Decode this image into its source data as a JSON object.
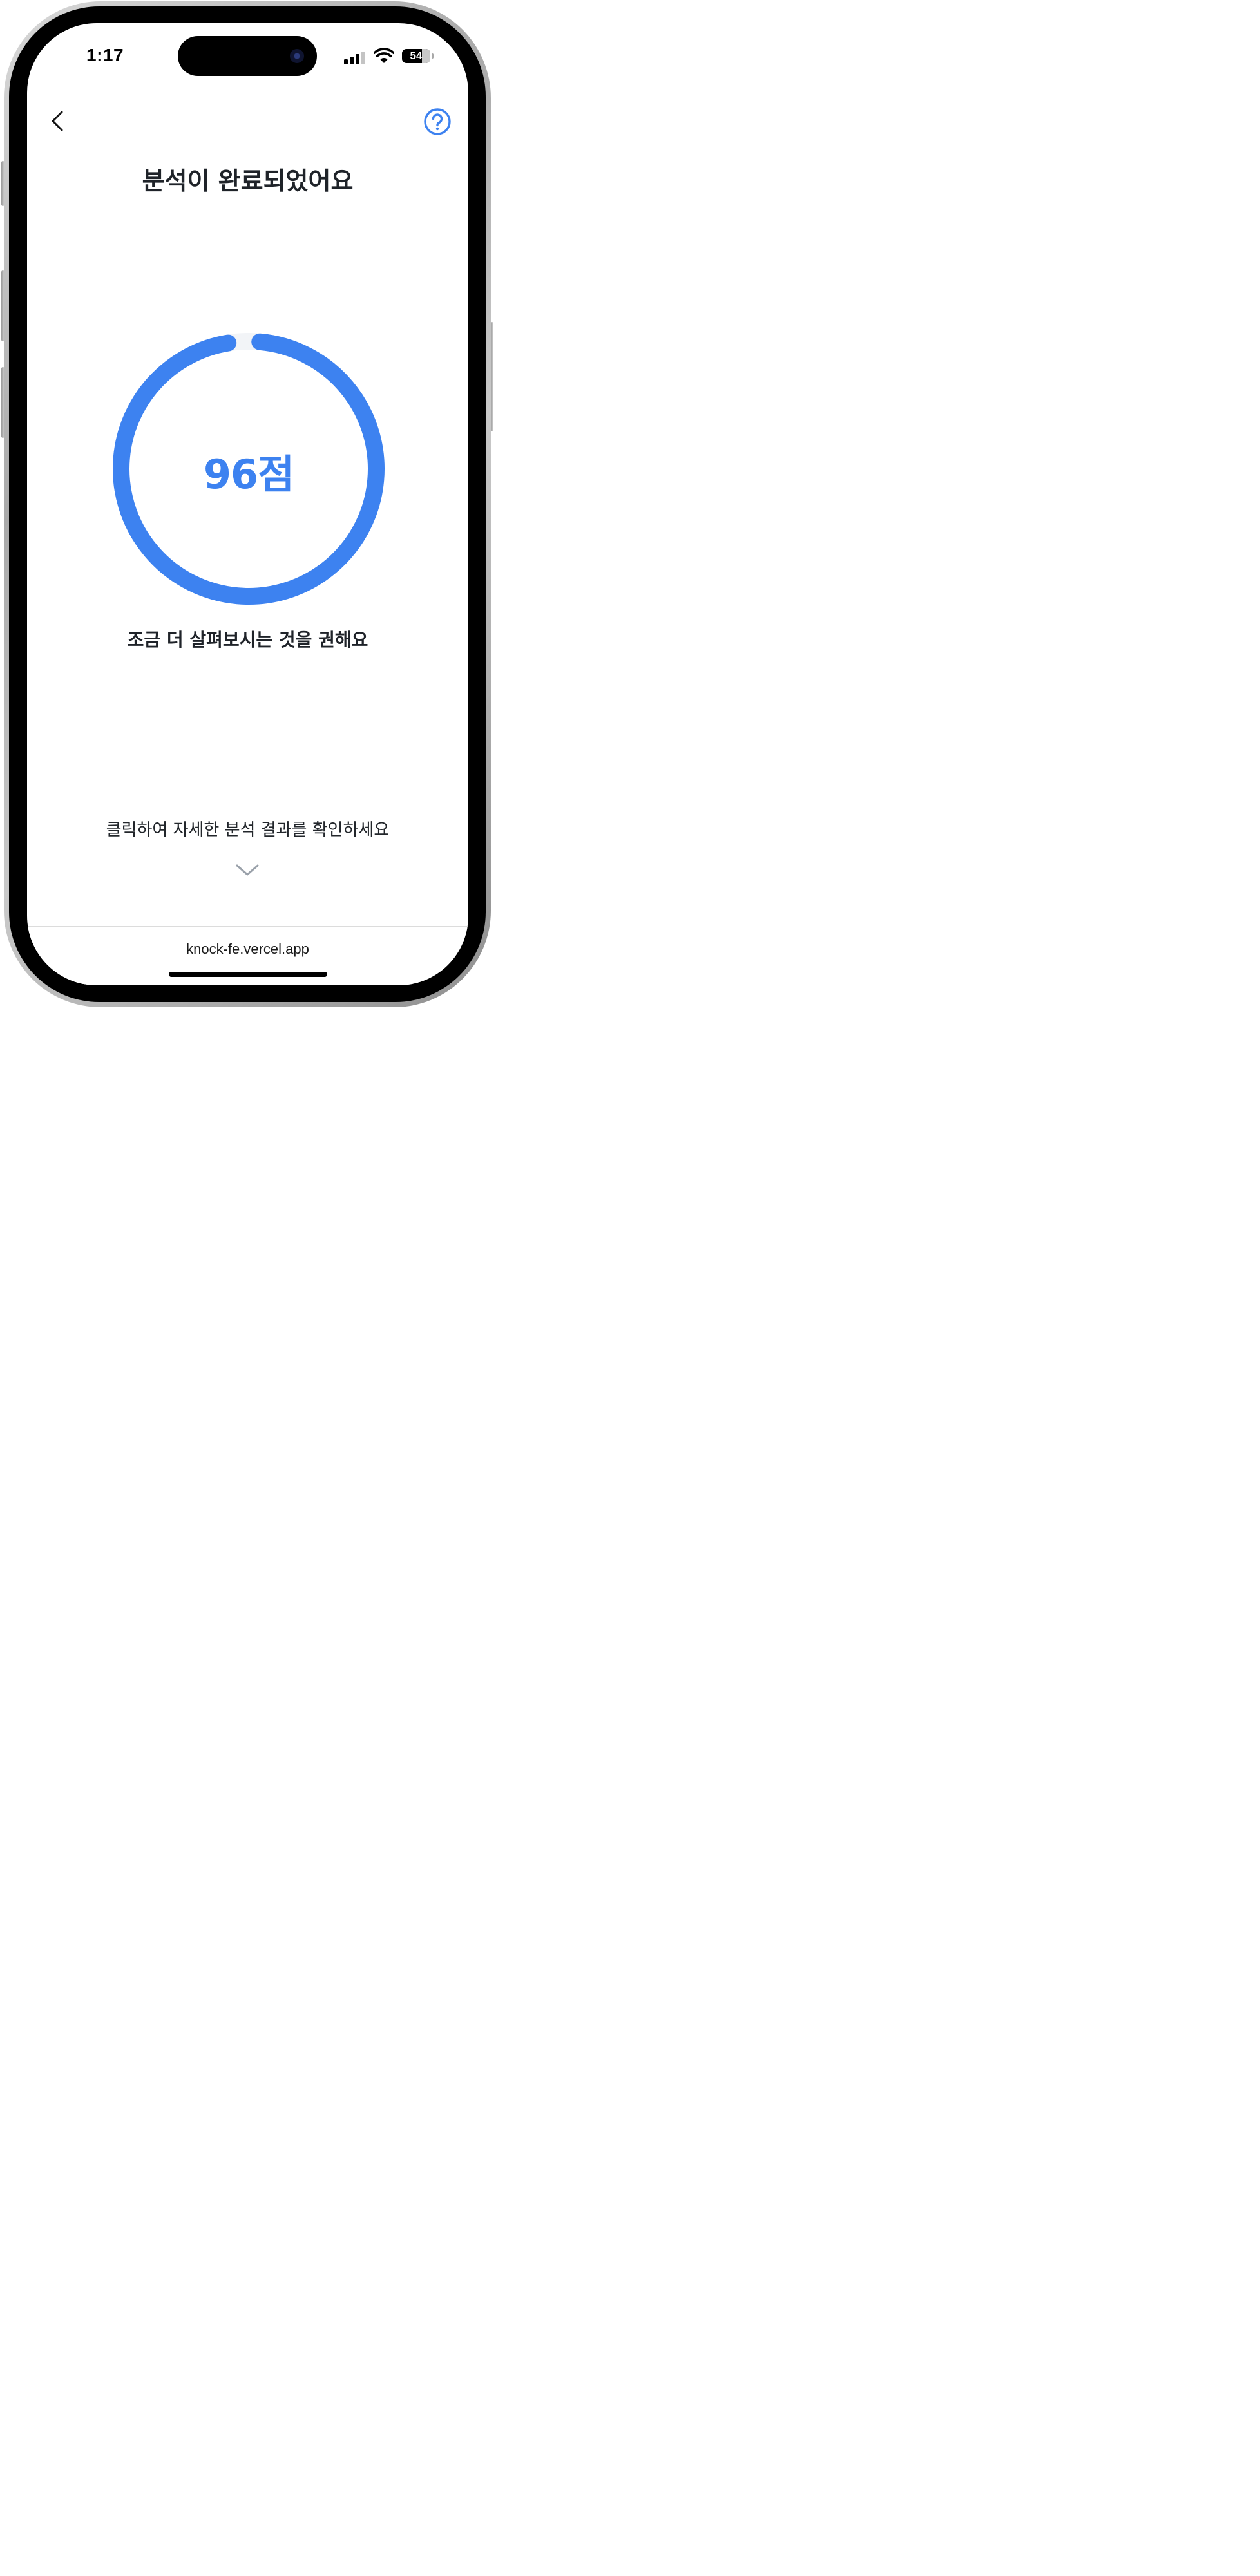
{
  "status_bar": {
    "time": "1:17",
    "battery_level": "54",
    "battery_fraction": 0.54
  },
  "header": {
    "back_icon": "chevron-left-icon",
    "help_icon": "question-circle-icon"
  },
  "title": "분석이 완료되었어요",
  "score": {
    "label": "96점",
    "value": 96,
    "max": 100
  },
  "verdict": "조금 더 살펴보시는 것을 권해요",
  "cta": {
    "text": "클릭하여 자세한 분석 결과를 확인하세요",
    "icon": "chevron-down-icon"
  },
  "browser": {
    "url": "knock-fe.vercel.app"
  },
  "colors": {
    "accent": "#3d82f0",
    "ring_track": "#f2f4f7",
    "text_primary": "#1f2329"
  }
}
